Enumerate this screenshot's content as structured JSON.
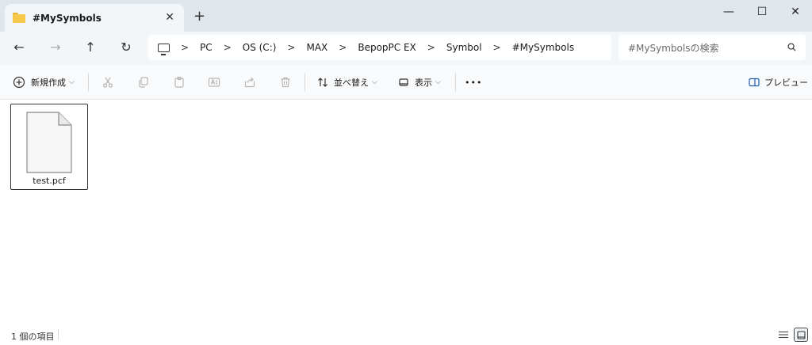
{
  "tab": {
    "title": "#MySymbols",
    "icon": "folder-icon"
  },
  "window_controls": {
    "minimize": "—",
    "maximize": "☐",
    "close": "✕",
    "new_tab": "+",
    "tab_close": "✕"
  },
  "nav": {
    "back": "←",
    "forward": "→",
    "up": "↑",
    "refresh": "↻"
  },
  "breadcrumb": [
    "PC",
    "OS (C:)",
    "MAX",
    "BepopPC EX",
    "Symbol",
    "#MySymbols"
  ],
  "search": {
    "placeholder": "#MySymbolsの検索"
  },
  "toolbar": {
    "new_label": "新規作成",
    "sort_label": "並べ替え",
    "view_label": "表示",
    "more_label": "•••",
    "preview_label": "プレビュー"
  },
  "files": [
    {
      "name": "test.pcf"
    }
  ],
  "status": {
    "item_count": "1 個の項目"
  },
  "colors": {
    "folder": "#f6c94a",
    "titlebar": "#dfe6ec",
    "navrow": "#f3f6f8"
  }
}
